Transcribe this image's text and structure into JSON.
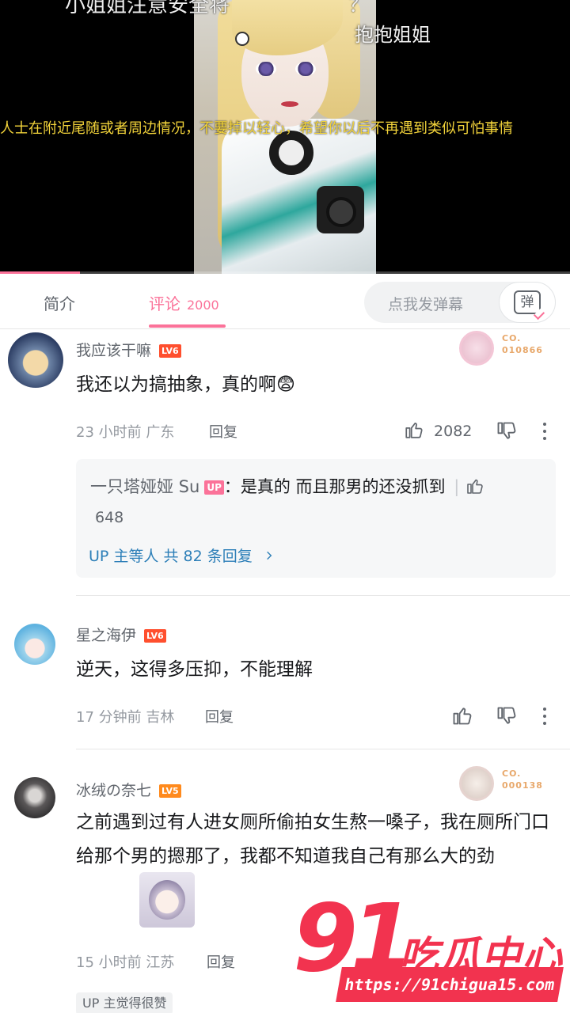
{
  "video": {
    "subtitle_top": "小姐姐注意安全将",
    "subtitle_top_mark": "？",
    "subtitle_right": "抱抱姐姐",
    "subtitle_yellow": "人士在附近尾随或者周边情况，不要掉以轻心，希望你以后不再遇到类似可怕事情",
    "progress": 0.14
  },
  "tabs": {
    "intro": "简介",
    "comments": "评论",
    "comments_count": "2000",
    "danmaku_placeholder": "点我发弹幕",
    "danmaku_icon": "弹"
  },
  "comments": [
    {
      "username": "我应该干嘛",
      "level": "LV6",
      "content": "我还以为搞抽象，真的啊😨",
      "time": "23 小时前",
      "location": "广东",
      "reply_label": "回复",
      "likes": "2082",
      "medal": "CO.\n010866",
      "reply_preview": {
        "user": "一只塔娅娅 Su",
        "tag": "UP",
        "text": "：是真的 而且那男的还没抓到",
        "likes": "648",
        "more": "UP 主等人 共 82 条回复"
      }
    },
    {
      "username": "星之海伊",
      "level": "LV6",
      "content": "逆天，这得多压抑，不能理解",
      "time": "17 分钟前",
      "location": "吉林",
      "reply_label": "回复"
    },
    {
      "username": "冰绒の奈七",
      "level": "LV5",
      "content": "之前遇到过有人进女厕所偷拍女生熬一嗓子，我在厕所门口给那个男的摁那了，我都不知道我自己有那么大的劲",
      "time": "15 小时前",
      "location": "江苏",
      "reply_label": "回复",
      "medal": "CO.\n000138",
      "badge": "UP 主觉得很赞"
    }
  ],
  "watermark": {
    "number": "91",
    "text": "吃瓜中心",
    "url": "https://91chigua15.com"
  },
  "colors": {
    "accent": "#fb7299",
    "link": "#2d7fb8",
    "watermark": "#f2334f"
  }
}
